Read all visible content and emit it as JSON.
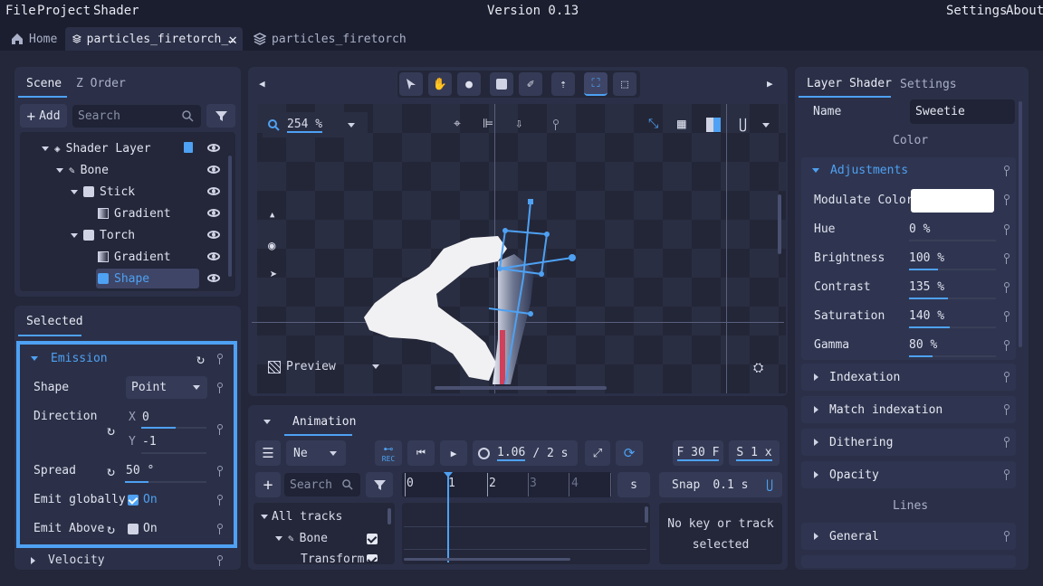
{
  "menu": {
    "file": "File",
    "project": "Project",
    "shader": "Shader",
    "version": "Version 0.13",
    "settings": "Settings",
    "about": "About"
  },
  "tabs": {
    "home": "Home",
    "active": "particles_firetorch_…",
    "other": "particles_firetorch"
  },
  "scene": {
    "tab_scene": "Scene",
    "tab_zorder": "Z Order",
    "add": "Add",
    "search_placeholder": "Search",
    "tree": [
      {
        "label": "Shader Layer",
        "icon": "layers-icon"
      },
      {
        "label": "Bone",
        "icon": "bone-icon"
      },
      {
        "label": "Stick",
        "icon": "square-icon"
      },
      {
        "label": "Gradient",
        "icon": "gradient-icon"
      },
      {
        "label": "Torch",
        "icon": "square-icon"
      },
      {
        "label": "Gradient",
        "icon": "gradient-icon"
      },
      {
        "label": "Shape",
        "icon": "shape-icon"
      }
    ]
  },
  "selected": {
    "title": "Selected",
    "section": "Emission",
    "shape_label": "Shape",
    "shape_value": "Point",
    "direction_label": "Direction",
    "x_label": "X",
    "x_value": "0",
    "y_label": "Y",
    "y_value": "-1",
    "spread_label": "Spread",
    "spread_value": "50 °",
    "emit_globally_label": "Emit globally",
    "emit_globally_value": "On",
    "emit_globally_checked": true,
    "emit_above_label": "Emit Above",
    "emit_above_value": "On",
    "emit_above_checked": false,
    "velocity": "Velocity"
  },
  "viewport": {
    "zoom": "254 %",
    "preview": "Preview"
  },
  "animation": {
    "tab": "Animation",
    "mode": "Ne",
    "time": "1.06",
    "duration": "/ 2 s",
    "fps": "F 30 F",
    "speed": "S 1 x",
    "search_placeholder": "Search",
    "ruler": [
      "0",
      "1",
      "2",
      "3",
      "4"
    ],
    "unit": "s",
    "snap_label": "Snap",
    "snap_value": "0.1 s",
    "tracks_all": "All tracks",
    "track_bone": "Bone",
    "track_transform": "Transform",
    "no_key": "No key or track selected",
    "rec": "REC"
  },
  "layer_shader": {
    "tab_layer": "Layer Shader",
    "tab_settings": "Settings",
    "name_label": "Name",
    "name_value": "Sweetie",
    "color_title": "Color",
    "adjustments": "Adjustments",
    "modulate_label": "Modulate Color",
    "modulate_color": "#ffffff",
    "params": [
      {
        "label": "Hue",
        "value": "0 %",
        "fraction": 0.0
      },
      {
        "label": "Brightness",
        "value": "100 %",
        "fraction": 0.33
      },
      {
        "label": "Contrast",
        "value": "135 %",
        "fraction": 0.45
      },
      {
        "label": "Saturation",
        "value": "140 %",
        "fraction": 0.47
      },
      {
        "label": "Gamma",
        "value": "80 %",
        "fraction": 0.27
      }
    ],
    "sections": [
      "Indexation",
      "Match indexation",
      "Dithering",
      "Opacity"
    ],
    "lines_title": "Lines",
    "general": "General"
  },
  "colors": {
    "accent": "#4ea1f3",
    "panel": "#2b3048",
    "bg": "#1b1e2e"
  }
}
